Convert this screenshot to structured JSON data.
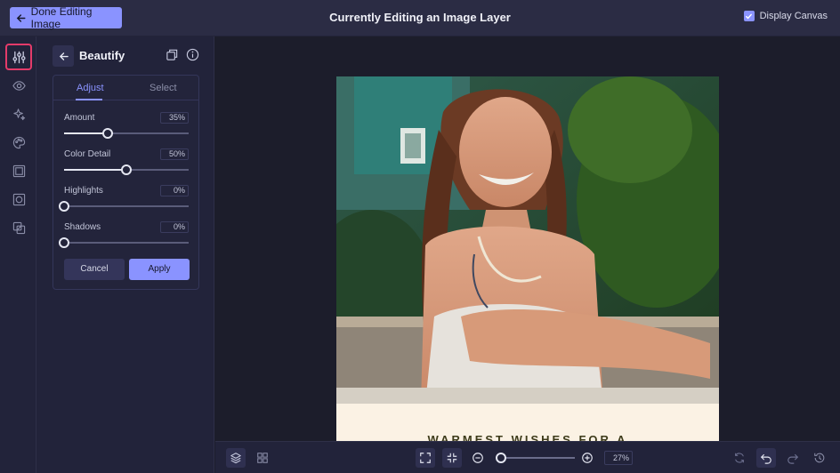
{
  "topbar": {
    "done_label": "Done Editing Image",
    "title": "Currently Editing an Image Layer",
    "display_canvas_label": "Display Canvas",
    "display_canvas_checked": true
  },
  "toolbar": {
    "icons": [
      "sliders-icon",
      "eye-icon",
      "sparkle-icon",
      "palette-icon",
      "frame-icon",
      "crop-frame-icon",
      "layers-overlap-icon"
    ],
    "active": "sliders-icon"
  },
  "panel": {
    "title": "Beautify",
    "tabs": [
      {
        "label": "Adjust",
        "active": true
      },
      {
        "label": "Select",
        "active": false
      }
    ],
    "sliders": [
      {
        "label": "Amount",
        "value": 35,
        "display": "35%"
      },
      {
        "label": "Color Detail",
        "value": 50,
        "display": "50%"
      },
      {
        "label": "Highlights",
        "value": 0,
        "display": "0%"
      },
      {
        "label": "Shadows",
        "value": 0,
        "display": "0%"
      }
    ],
    "cancel_label": "Cancel",
    "apply_label": "Apply"
  },
  "canvas": {
    "caption": "WARMEST WISHES FOR A"
  },
  "bottombar": {
    "zoom_value": 27,
    "zoom_display": "27%"
  },
  "colors": {
    "accent": "#8a93ff",
    "active_outline": "#e43b6a",
    "topbar_bg": "#2b2c44",
    "panel_bg": "#22233a",
    "canvas_bg": "#1c1d2b",
    "caption_bg": "#fbf2e4"
  }
}
